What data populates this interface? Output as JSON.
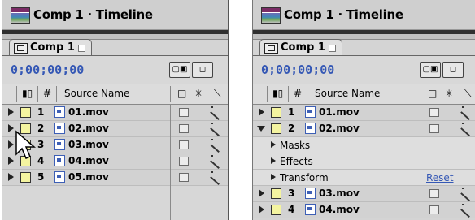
{
  "left": {
    "window_title": "Comp 1 · Timeline",
    "tab_label": "Comp 1",
    "timecode": "0;00;00;00",
    "header": {
      "num": "#",
      "source_name": "Source Name"
    },
    "layers": [
      {
        "num": "1",
        "name": "01.mov"
      },
      {
        "num": "2",
        "name": "02.mov"
      },
      {
        "num": "3",
        "name": "03.mov"
      },
      {
        "num": "4",
        "name": "04.mov"
      },
      {
        "num": "5",
        "name": "05.mov"
      }
    ]
  },
  "right": {
    "window_title": "Comp 1 · Timeline",
    "tab_label": "Comp 1",
    "timecode": "0;00;00;00",
    "header": {
      "num": "#",
      "source_name": "Source Name"
    },
    "layers": [
      {
        "num": "1",
        "name": "01.mov"
      },
      {
        "num": "2",
        "name": "02.mov"
      },
      {
        "num": "3",
        "name": "03.mov"
      },
      {
        "num": "4",
        "name": "04.mov"
      }
    ],
    "sub_items": [
      "Masks",
      "Effects",
      "Transform"
    ],
    "reset_label": "Reset"
  },
  "colors": {
    "timecode": "#3558b5",
    "label_yellow": "#f4f4a0",
    "panel_bg": "#d4d4d4"
  }
}
